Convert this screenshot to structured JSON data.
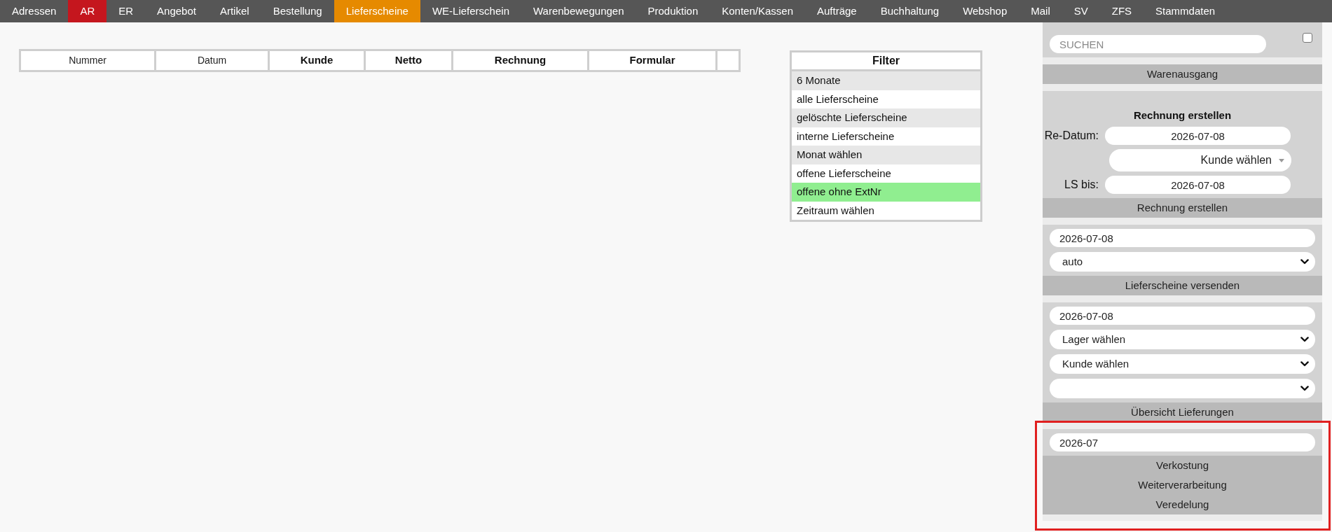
{
  "nav": {
    "items": [
      {
        "label": "Adressen",
        "selected": false
      },
      {
        "label": "AR",
        "selected": false,
        "color": "#c5161e"
      },
      {
        "label": "ER",
        "selected": false
      },
      {
        "label": "Angebot",
        "selected": false
      },
      {
        "label": "Artikel",
        "selected": false
      },
      {
        "label": "Bestellung",
        "selected": false
      },
      {
        "label": "Lieferscheine",
        "selected": true
      },
      {
        "label": "WE-Lieferschein",
        "selected": false
      },
      {
        "label": "Warenbewegungen",
        "selected": false
      },
      {
        "label": "Produktion",
        "selected": false
      },
      {
        "label": "Konten/Kassen",
        "selected": false
      },
      {
        "label": "Aufträge",
        "selected": false
      },
      {
        "label": "Buchhaltung",
        "selected": false
      },
      {
        "label": "Webshop",
        "selected": false
      },
      {
        "label": "Mail",
        "selected": false
      },
      {
        "label": "SV",
        "selected": false
      },
      {
        "label": "ZFS",
        "selected": false
      },
      {
        "label": "Stammdaten",
        "selected": false
      }
    ]
  },
  "table": {
    "columns": [
      {
        "kind": "plain",
        "label": "Nummer"
      },
      {
        "kind": "plain",
        "label": "Datum"
      },
      {
        "kind": "bold",
        "label": "Kunde"
      },
      {
        "kind": "bold",
        "label": "Netto"
      },
      {
        "kind": "bold",
        "label": "Rechnung"
      },
      {
        "kind": "bold",
        "label": "Formular"
      },
      {
        "kind": "empty"
      }
    ]
  },
  "filter": {
    "title": "Filter",
    "rows": [
      {
        "label": "6 Monate",
        "selected": false
      },
      {
        "label": "alle Lieferscheine",
        "selected": false
      },
      {
        "label": "gelöschte Lieferscheine",
        "selected": false
      },
      {
        "label": "interne Lieferscheine",
        "selected": false
      },
      {
        "label": "Monat wählen",
        "selected": false
      },
      {
        "label": "offene Lieferscheine",
        "selected": false
      },
      {
        "label": "offene ohne ExtNr",
        "selected": true
      },
      {
        "label": "Zeitraum wählen",
        "selected": false
      }
    ]
  },
  "sidebar": {
    "search": {
      "placeholder": "SUCHEN"
    },
    "checkbox": {
      "checked": false
    },
    "panels": [
      {
        "buttons": [
          "Warenausgang"
        ]
      },
      {
        "title": "Rechnung erstellen",
        "fields": [
          {
            "kind": "date",
            "label": "Re-Datum:",
            "value": "2026-07-08"
          },
          {
            "kind": "combo",
            "value": "Kunde wählen"
          },
          {
            "kind": "date",
            "label": "LS bis:",
            "value": "2026-07-08"
          }
        ],
        "buttons": [
          "Rechnung erstellen"
        ]
      },
      {
        "fields": [
          {
            "kind": "input",
            "value": "2026-07-08"
          },
          {
            "kind": "select",
            "value": "auto"
          }
        ],
        "buttons": [
          "Lieferscheine versenden"
        ]
      },
      {
        "fields": [
          {
            "kind": "input",
            "value": "2026-07-08"
          },
          {
            "kind": "select",
            "value": "Lager wählen"
          },
          {
            "kind": "select",
            "value": "Kunde wählen"
          },
          {
            "kind": "select"
          }
        ],
        "buttons": [
          "Übersicht Lieferungen"
        ]
      },
      {
        "fields": [
          {
            "kind": "input",
            "value": "2026-07"
          }
        ],
        "buttons": [
          "Verkostung",
          "Weiterverarbeitung",
          "Veredelung"
        ]
      }
    ]
  }
}
